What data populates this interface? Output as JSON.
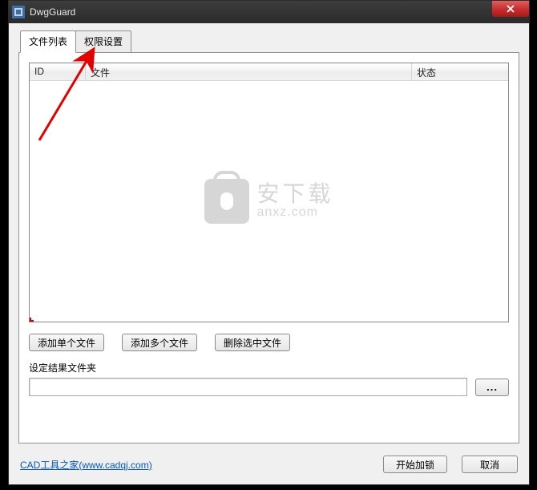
{
  "window": {
    "title": "DwgGuard"
  },
  "tabs": {
    "file_list": "文件列表",
    "perm_settings": "权限设置"
  },
  "columns": {
    "id": "ID",
    "file": "文件",
    "status": "状态"
  },
  "buttons": {
    "add_single": "添加单个文件",
    "add_multi": "添加多个文件",
    "delete_selected": "删除选中文件",
    "browse": "...",
    "start_lock": "开始加锁",
    "cancel": "取消"
  },
  "labels": {
    "result_folder": "设定结果文件夹"
  },
  "inputs": {
    "result_folder_value": ""
  },
  "footer": {
    "link_text": "CAD工具之家(www.cadqj.com)"
  },
  "watermark": {
    "cn": "安下载",
    "en": "anxz.com"
  }
}
